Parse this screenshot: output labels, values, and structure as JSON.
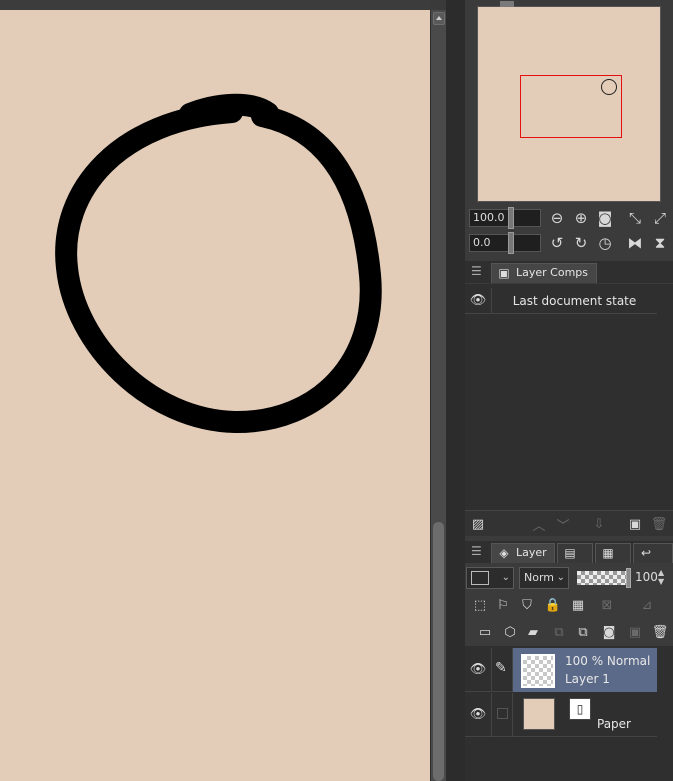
{
  "navigator": {
    "zoom_value": "100.0",
    "rotation_value": "0.0",
    "viewport_color": "#e41010",
    "zoom_buttons": [
      "zoom-out-icon",
      "zoom-in-icon",
      "fit-icon",
      "actual-size-icon",
      "fit-window-icon"
    ],
    "rotate_buttons": [
      "rotate-left-icon",
      "rotate-right-icon",
      "reset-rotation-icon",
      "flip-horizontal-icon",
      "flip-vertical-icon"
    ]
  },
  "layer_comps": {
    "tab_label": "Layer Comps",
    "rows": [
      {
        "label": "Last document state"
      }
    ]
  },
  "layer_panel": {
    "tab_label": "Layer",
    "blend_mode": "Norm",
    "opacity_value": "100",
    "layers": [
      {
        "mode_label": "100 % Normal",
        "name": "Layer 1",
        "selected": true
      },
      {
        "name": "Paper",
        "selected": false
      }
    ]
  },
  "colors": {
    "canvas": "#e3cdb8",
    "selection": "#5b6a88",
    "panel_bg": "#2f2f2f"
  }
}
